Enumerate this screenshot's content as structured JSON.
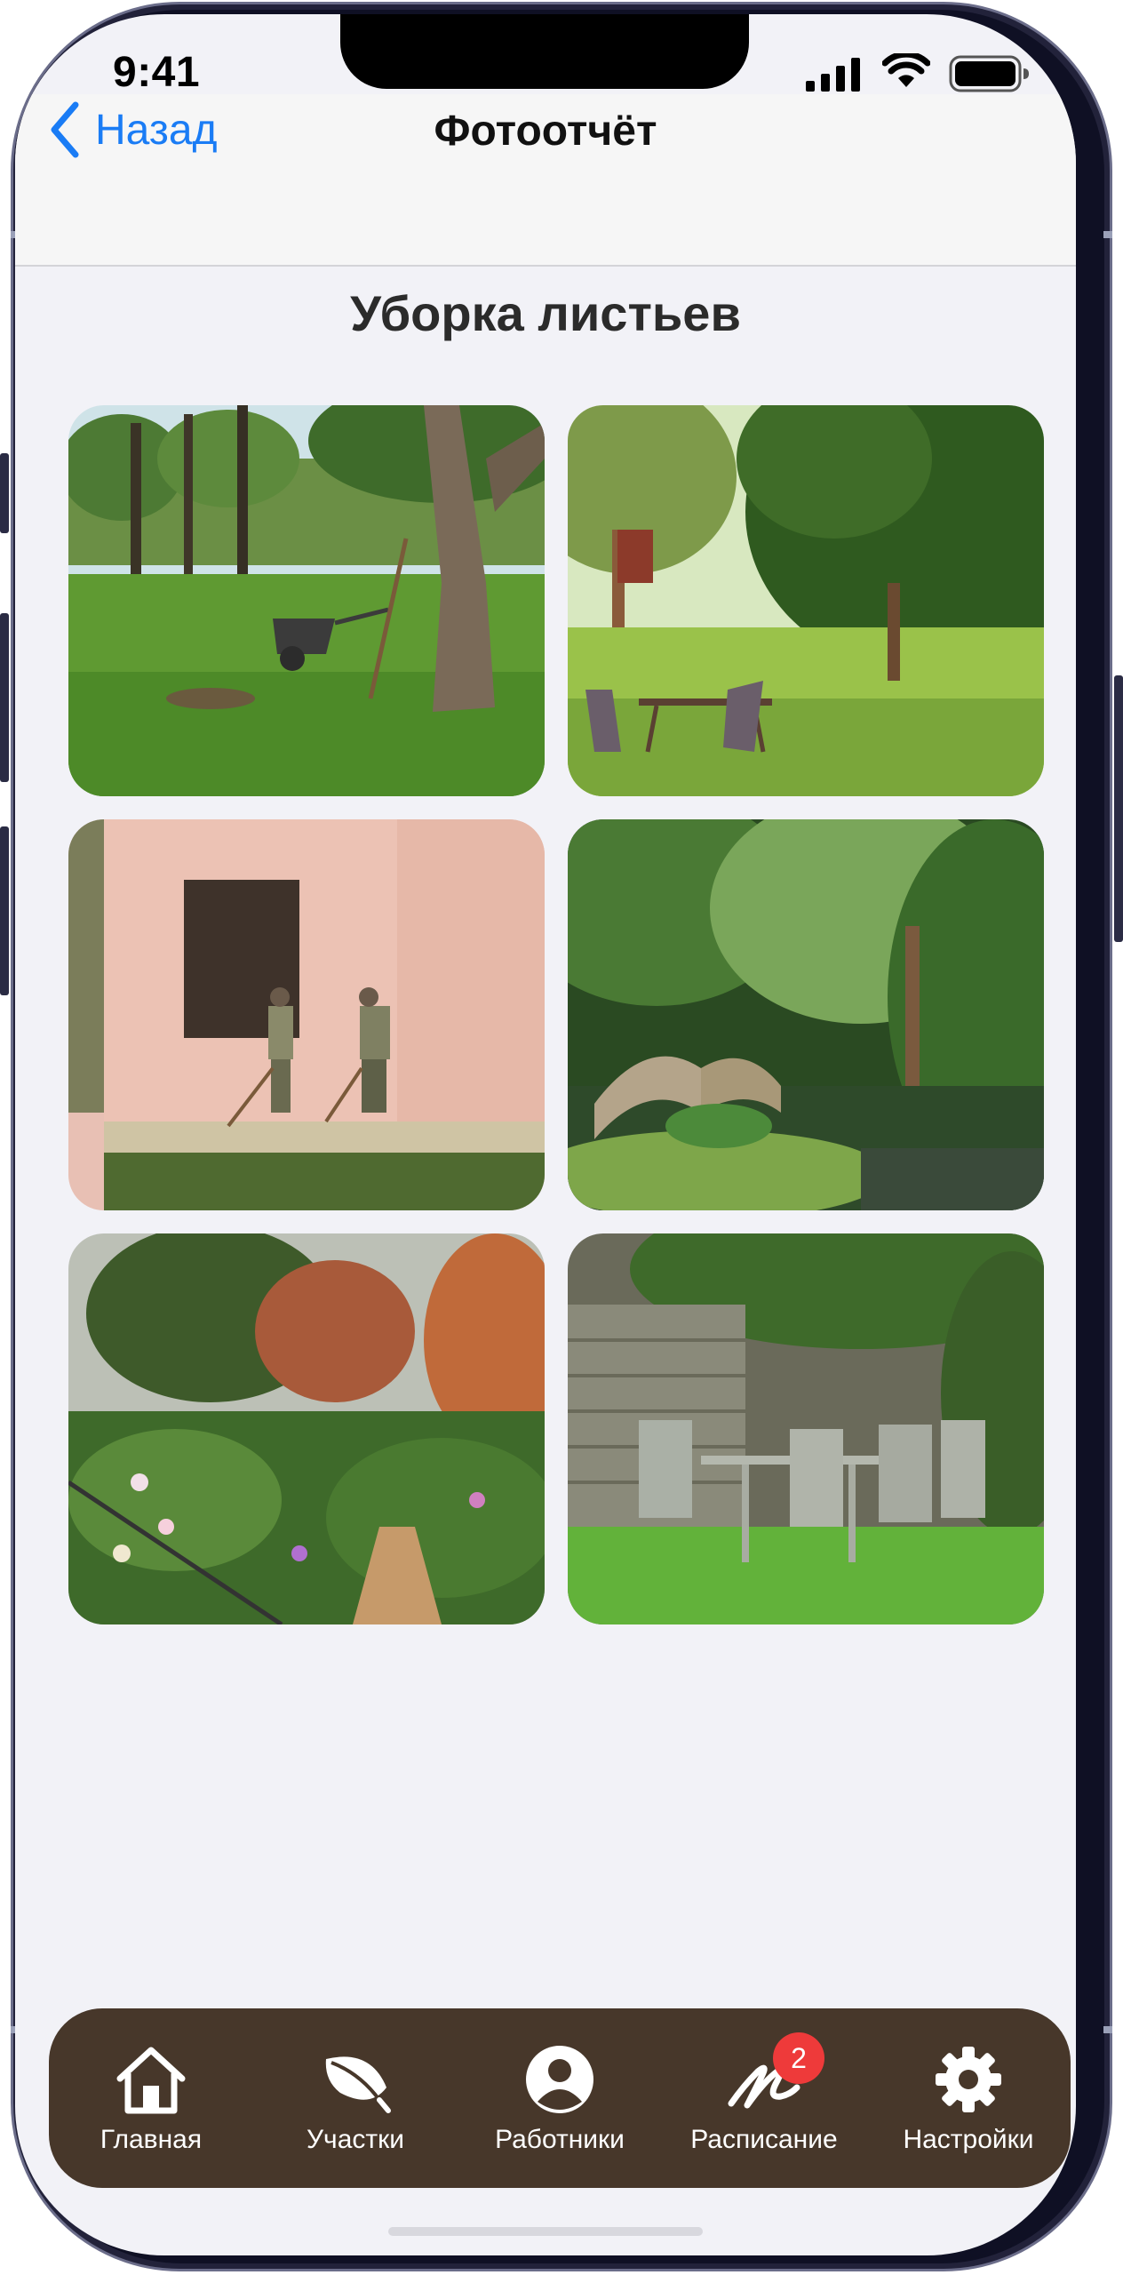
{
  "status_bar": {
    "time": "9:41"
  },
  "nav": {
    "back_label": "Назад",
    "title": "Фотоотчёт"
  },
  "page": {
    "title": "Уборка листьев"
  },
  "photos": [
    {
      "description": "garden"
    },
    {
      "description": "garden"
    },
    {
      "description": "garden"
    },
    {
      "description": "garden"
    },
    {
      "description": "garden"
    },
    {
      "description": "garden"
    }
  ],
  "tabbar": {
    "items": [
      {
        "label": "Главная",
        "icon": "house-icon"
      },
      {
        "label": "Участки",
        "icon": "leaf-icon"
      },
      {
        "label": "Работники",
        "icon": "person-icon"
      },
      {
        "label": "Расписание",
        "icon": "signature-icon",
        "badge": "2"
      },
      {
        "label": "Настройки",
        "icon": "gear-icon"
      }
    ]
  },
  "colors": {
    "accent": "#1a7cf5",
    "tabbar_bg": "#47372a",
    "badge": "#ee3a3a",
    "background": "#f2f2f7"
  }
}
